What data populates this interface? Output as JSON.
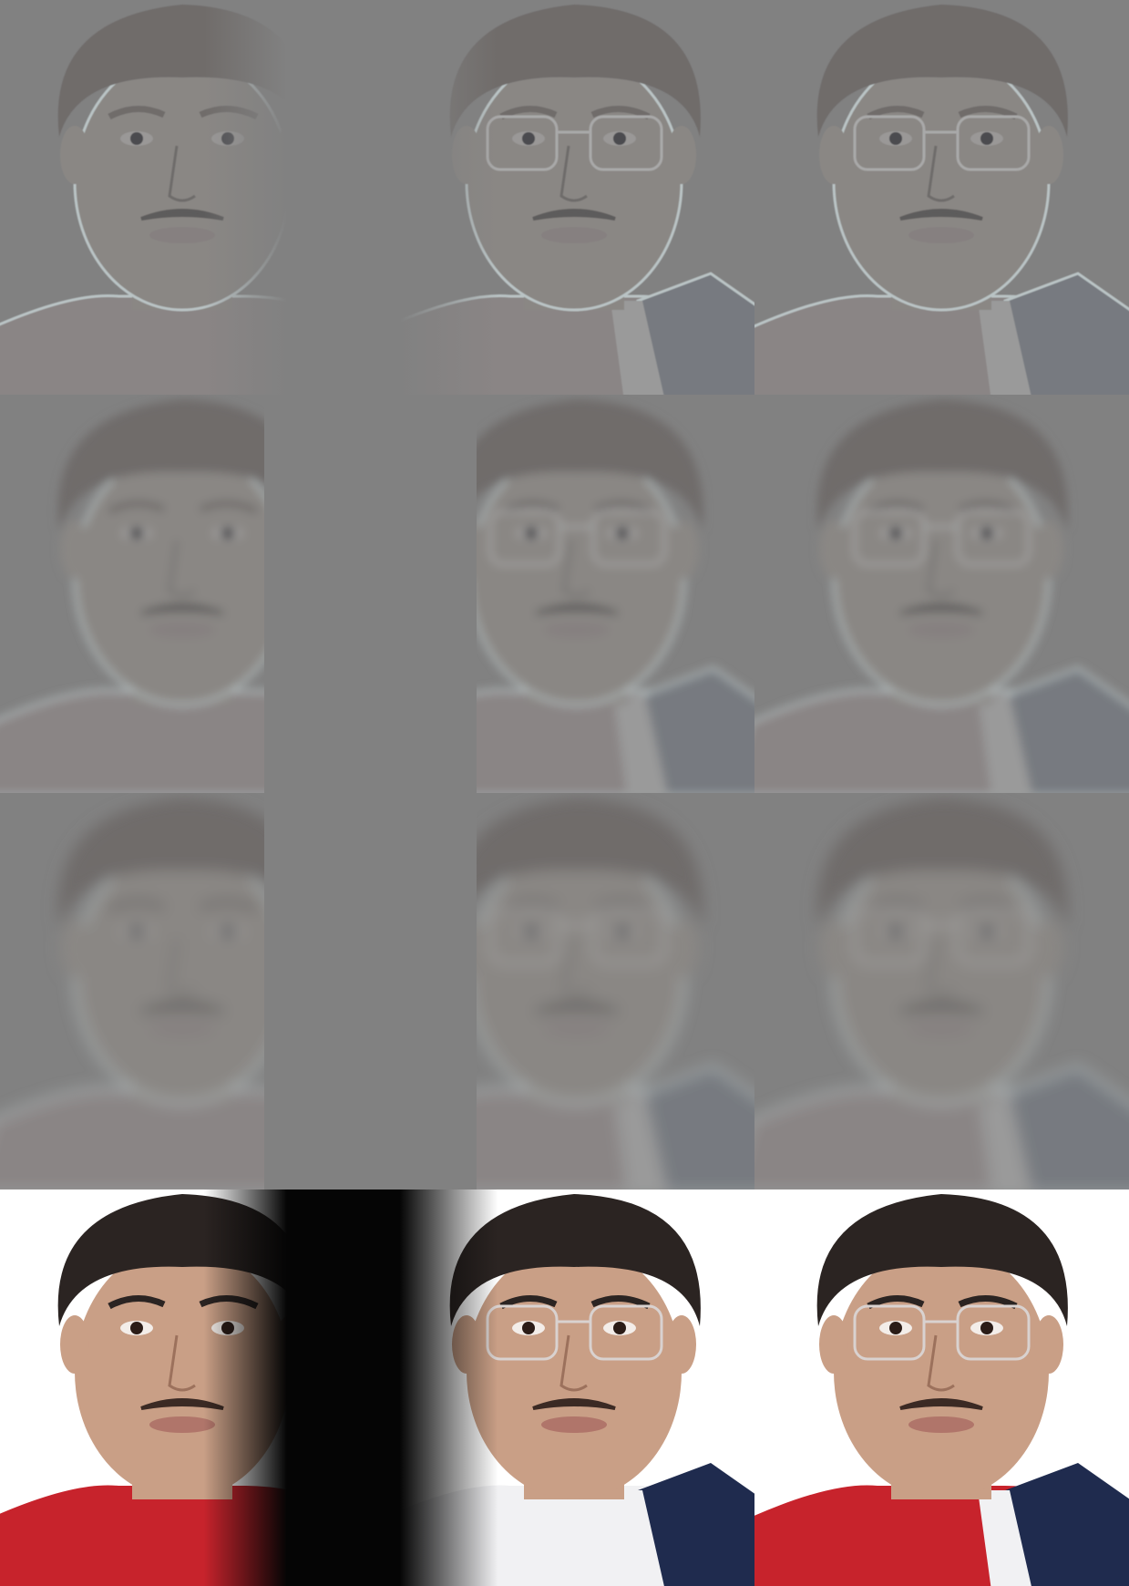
{
  "figure": {
    "background": "#ffffff",
    "mid_gray": "#818181",
    "rows": [
      {
        "level": "laplacian-high-frequency",
        "tiles": [
          "left-masked",
          "right-masked",
          "blended"
        ]
      },
      {
        "level": "laplacian-mid-frequency",
        "tiles": [
          "left-masked",
          "right-masked",
          "blended"
        ]
      },
      {
        "level": "laplacian-low-frequency",
        "tiles": [
          "left-masked",
          "right-masked",
          "blended"
        ]
      },
      {
        "level": "reconstruction",
        "tiles": [
          "left-masked",
          "right-masked",
          "blended"
        ]
      }
    ],
    "colors": {
      "hair": "#2b2422",
      "skin": "#c99f86",
      "shirt_red": "#c7232c",
      "shirt_white": "#f1f1f3",
      "jacket_navy": "#1f2b4e",
      "bg_white": "#ffffff",
      "dark_gap": "#050505",
      "glasses": "#d9d2d0"
    }
  }
}
